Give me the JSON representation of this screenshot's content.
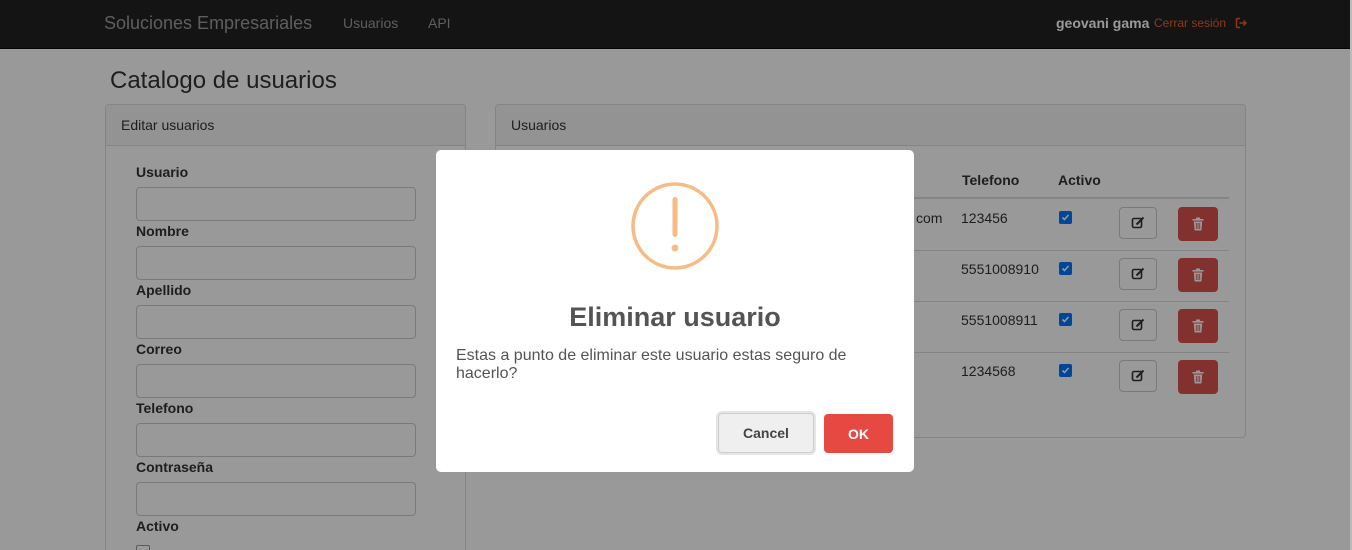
{
  "navbar": {
    "brand": "Soluciones Empresariales",
    "links": [
      "Usuarios",
      "API"
    ],
    "user_name": "geovani gama",
    "logout_label": "Cerrar sesión"
  },
  "page": {
    "title": "Catalogo de usuarios"
  },
  "edit_panel": {
    "heading": "Editar usuarios",
    "fields": [
      {
        "label": "Usuario",
        "value": ""
      },
      {
        "label": "Nombre",
        "value": ""
      },
      {
        "label": "Apellido",
        "value": ""
      },
      {
        "label": "Correo",
        "value": ""
      },
      {
        "label": "Telefono",
        "value": ""
      },
      {
        "label": "Contraseña",
        "value": ""
      }
    ],
    "active_label": "Activo"
  },
  "users_panel": {
    "heading": "Usuarios",
    "columns": [
      "Telefono",
      "Activo"
    ],
    "rows": [
      {
        "email_fragment": "com",
        "telefono": "123456",
        "activo": true
      },
      {
        "email_fragment": "",
        "telefono": "5551008910",
        "activo": true
      },
      {
        "email_fragment": "",
        "telefono": "5551008911",
        "activo": true
      },
      {
        "email_fragment": "",
        "telefono": "1234568",
        "activo": true
      }
    ]
  },
  "modal": {
    "icon": "warning-exclamation-icon",
    "title": "Eliminar usuario",
    "text": "Estas a punto de eliminar este usuario estas seguro de hacerlo?",
    "cancel_label": "Cancel",
    "ok_label": "OK"
  },
  "colors": {
    "navbar_bg": "#222222",
    "logout": "#e9602c",
    "delete_button": "#d9534f",
    "ok_button": "#e64942",
    "warning_icon": "#f8bb86",
    "checkbox": "#0075ff"
  }
}
